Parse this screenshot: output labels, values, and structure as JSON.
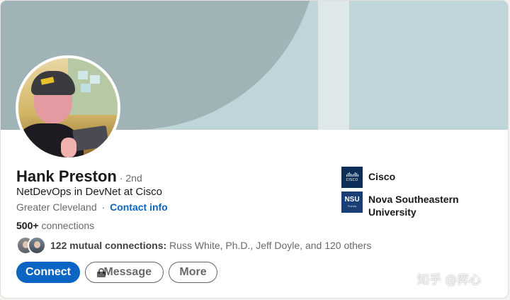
{
  "profile": {
    "name": "Hank Preston",
    "degree": "· 2nd",
    "headline": "NetDevOps in DevNet at Cisco",
    "location": "Greater Cleveland",
    "separator": "·",
    "contact_info_label": "Contact info",
    "connections_count": "500+",
    "connections_label": "connections"
  },
  "mutual": {
    "bold_text": "122 mutual connections:",
    "names_text": "Russ White, Ph.D., Jeff Doyle, and 120 others"
  },
  "actions": {
    "connect_label": "Connect",
    "message_label": "Message",
    "more_label": "More"
  },
  "orgs": {
    "current_company": "Cisco",
    "cisco_logo_text": "CISCO",
    "education": "Nova Southeastern University",
    "nsu_logo_text": "NSU",
    "nsu_logo_sub": "Florida"
  },
  "watermark": {
    "text": "知乎 @弈心"
  },
  "colors": {
    "accent": "#0a66c2",
    "banner_dark": "#a0b4b7",
    "banner_light": "#c0d5da"
  },
  "icons": {
    "message": "lock-icon"
  }
}
